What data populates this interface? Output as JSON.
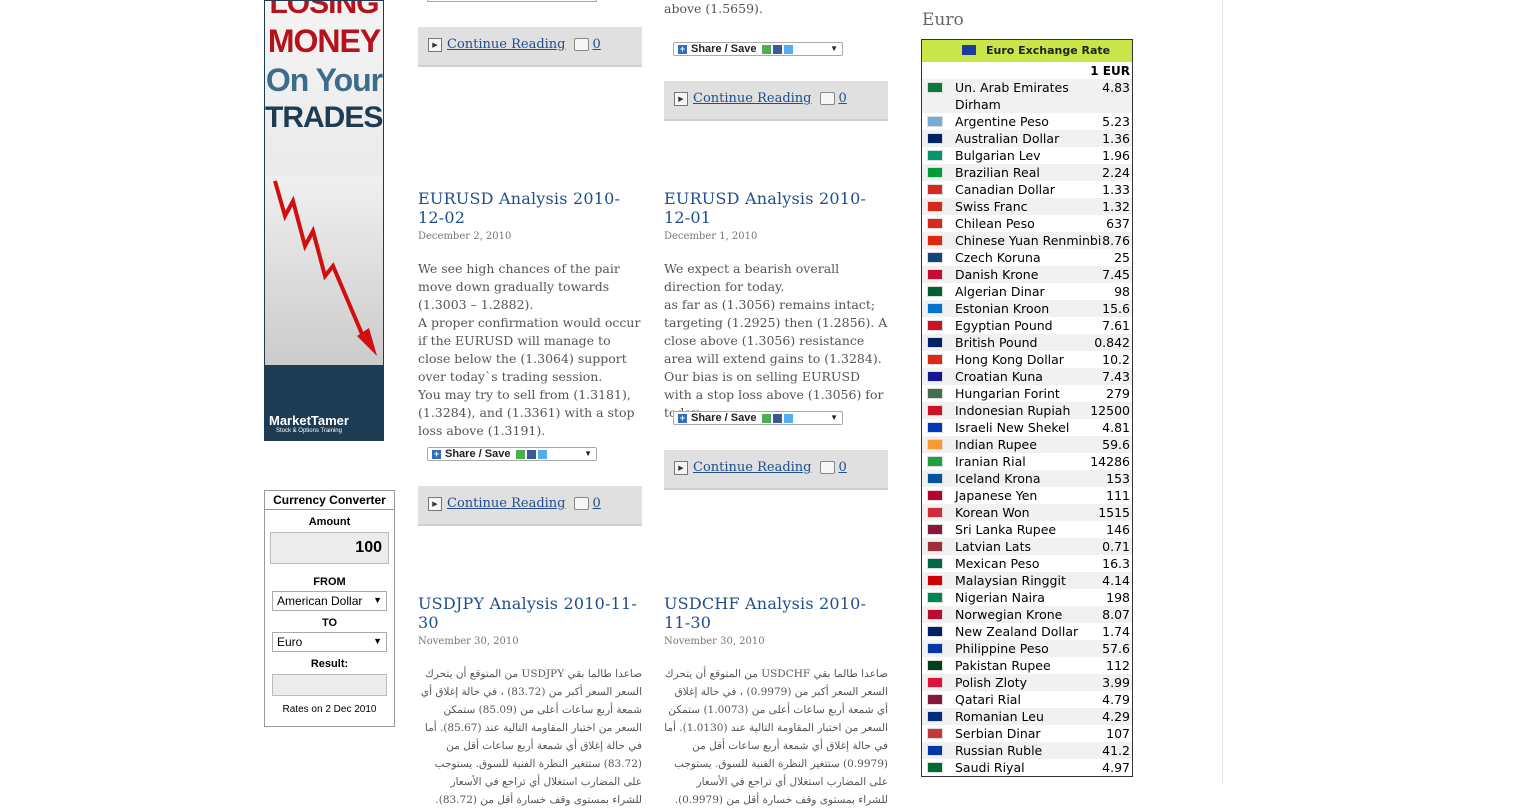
{
  "ad": {
    "line1": "LOSING",
    "line2": "MONEY",
    "line3": "On Your",
    "line4": "TRADES",
    "line4_mark": "?",
    "brand": "MarketTamer",
    "brand_sub": "Stock & Options Training"
  },
  "converter": {
    "title": "Currency Converter",
    "amount_label": "Amount",
    "amount_value": "100",
    "from_label": "FROM",
    "from_value": "American Dollar",
    "to_label": "TO",
    "to_value": "Euro",
    "result_label": "Result:",
    "rates_note": "Rates on 2 Dec 2010"
  },
  "colors": {
    "link": "#1f4e8c",
    "rates_header": "#c8e64a"
  },
  "top_posts": {
    "left": {
      "comments": "0"
    },
    "right": {
      "tail": "above (1.5659).",
      "comments": "0"
    }
  },
  "share_label": "Share / Save",
  "continue_label": "Continue Reading",
  "posts": [
    {
      "title": "EURUSD Analysis 2010-12-02",
      "date": "December 2, 2010",
      "lines": [
        "We see high chances of the pair move down gradually towards (1.3003 – 1.2882).",
        "A proper confirmation would occur if the EURUSD will manage to close below the (1.3064) support over today`s trading session.",
        "You may try to sell from (1.3181), (1.3284), and (1.3361) with a stop loss above (1.3191)."
      ],
      "comments": "0"
    },
    {
      "title": "EURUSD Analysis 2010-12-01",
      "date": "December 1, 2010",
      "lines": [
        "We expect a bearish overall direction for today.",
        "as far as (1.3056) remains intact; targeting (1.2925) then (1.2856). A close above (1.3056) resistance area will extend gains to (1.3284).",
        "Our bias is on selling EURUSD with a stop loss above (1.3056) for today."
      ],
      "comments": "0"
    },
    {
      "title": "USDJPY Analysis 2010-11-30",
      "date": "November 30, 2010",
      "arabic": "صاعدا طالما بقي USDJPY من المتوقع أن يتحرك السعر السعر أكبر من (83.72) ، في حالة إغلاق أي شمعة أربع ساعات أعلى من (85.09) ستمكن السعر من اختبار المقاومة التالية عند (85.67). أما في حالة إغلاق أي شمعة أربع ساعات أقل من (83.72) ستتغير النظرة الفنية للسوق. يستوجب على المضارب استغلال أي تراجع في الأسعار للشراء بمستوى وقف خسارة أقل من (83.72)."
    },
    {
      "title": "USDCHF Analysis 2010-11-30",
      "date": "November 30, 2010",
      "arabic": "صاعدا طالما بقي USDCHF من المتوقع أن يتحرك السعر السعر أكبر من (0.9979) ، في حالة إغلاق أي شمعة أربع ساعات أعلى من (1.0073) ستمكن السعر من اختبار المقاومة التالية عند (1.0130). أما في حالة إغلاق أي شمعة أربع ساعات أقل من (0.9979) ستتغير النظرة الفنية للسوق. يستوجب على المضارب استغلال أي تراجع في الأسعار للشراء بمستوى وقف خسارة أقل من (0.9979)."
    }
  ],
  "sidebar": {
    "title": "Euro",
    "box_title": "Euro Exchange Rate",
    "unit": "1 EUR",
    "rates": [
      {
        "name": "Un. Arab Emirates Dirham",
        "value": "4.83",
        "flag": "#0a7a3c"
      },
      {
        "name": "Argentine Peso",
        "value": "5.23",
        "flag": "#75aadb"
      },
      {
        "name": "Australian Dollar",
        "value": "1.36",
        "flag": "#012169"
      },
      {
        "name": "Bulgarian Lev",
        "value": "1.96",
        "flag": "#00966e"
      },
      {
        "name": "Brazilian Real",
        "value": "2.24",
        "flag": "#009c3b"
      },
      {
        "name": "Canadian Dollar",
        "value": "1.33",
        "flag": "#d52b1e"
      },
      {
        "name": "Swiss Franc",
        "value": "1.32",
        "flag": "#d52b1e"
      },
      {
        "name": "Chilean Peso",
        "value": "637",
        "flag": "#d52b1e"
      },
      {
        "name": "Chinese Yuan Renminbi",
        "value": "8.76",
        "flag": "#de2910"
      },
      {
        "name": "Czech Koruna",
        "value": "25",
        "flag": "#11457e"
      },
      {
        "name": "Danish Krone",
        "value": "7.45",
        "flag": "#c60c30"
      },
      {
        "name": "Algerian Dinar",
        "value": "98",
        "flag": "#006233"
      },
      {
        "name": "Estonian Kroon",
        "value": "15.6",
        "flag": "#0072ce"
      },
      {
        "name": "Egyptian Pound",
        "value": "7.61",
        "flag": "#ce1126"
      },
      {
        "name": "British Pound",
        "value": "0.842",
        "flag": "#012169"
      },
      {
        "name": "Hong Kong Dollar",
        "value": "10.2",
        "flag": "#de2910"
      },
      {
        "name": "Croatian Kuna",
        "value": "7.43",
        "flag": "#171796"
      },
      {
        "name": "Hungarian Forint",
        "value": "279",
        "flag": "#436f4d"
      },
      {
        "name": "Indonesian Rupiah",
        "value": "12500",
        "flag": "#ce1126"
      },
      {
        "name": "Israeli New Shekel",
        "value": "4.81",
        "flag": "#0038b8"
      },
      {
        "name": "Indian Rupee",
        "value": "59.6",
        "flag": "#ff9933"
      },
      {
        "name": "Iranian Rial",
        "value": "14286",
        "flag": "#239f40"
      },
      {
        "name": "Iceland Krona",
        "value": "153",
        "flag": "#02529c"
      },
      {
        "name": "Japanese Yen",
        "value": "111",
        "flag": "#bc002d"
      },
      {
        "name": "Korean Won",
        "value": "1515",
        "flag": "#cd2e3a"
      },
      {
        "name": "Sri Lanka Rupee",
        "value": "146",
        "flag": "#8d153a"
      },
      {
        "name": "Latvian Lats",
        "value": "0.71",
        "flag": "#9e3039"
      },
      {
        "name": "Mexican Peso",
        "value": "16.3",
        "flag": "#006847"
      },
      {
        "name": "Malaysian Ringgit",
        "value": "4.14",
        "flag": "#cc0001"
      },
      {
        "name": "Nigerian Naira",
        "value": "198",
        "flag": "#008751"
      },
      {
        "name": "Norwegian Krone",
        "value": "8.07",
        "flag": "#ba0c2f"
      },
      {
        "name": "New Zealand Dollar",
        "value": "1.74",
        "flag": "#012169"
      },
      {
        "name": "Philippine Peso",
        "value": "57.6",
        "flag": "#0038a8"
      },
      {
        "name": "Pakistan Rupee",
        "value": "112",
        "flag": "#01411c"
      },
      {
        "name": "Polish Zloty",
        "value": "3.99",
        "flag": "#dc143c"
      },
      {
        "name": "Qatari Rial",
        "value": "4.79",
        "flag": "#8a1538"
      },
      {
        "name": "Romanian Leu",
        "value": "4.29",
        "flag": "#002b7f"
      },
      {
        "name": "Serbian Dinar",
        "value": "107",
        "flag": "#c6363c"
      },
      {
        "name": "Russian Ruble",
        "value": "41.2",
        "flag": "#0039a6"
      },
      {
        "name": "Saudi Riyal",
        "value": "4.97",
        "flag": "#006c35"
      }
    ]
  }
}
